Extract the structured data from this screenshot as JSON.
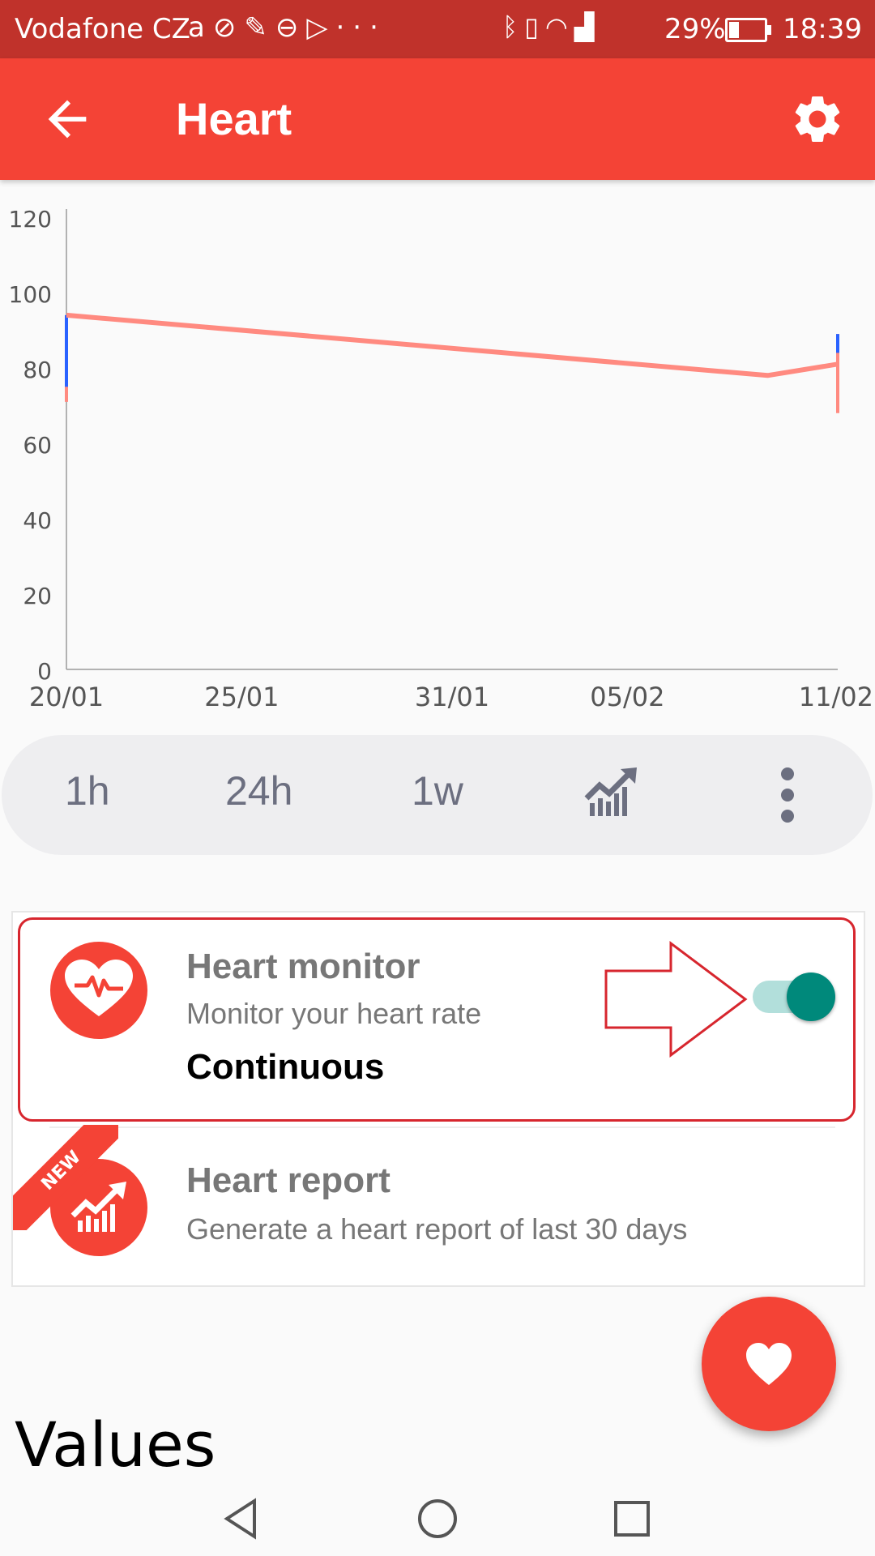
{
  "status_bar": {
    "carrier": "Vodafone CZ",
    "battery": "29%",
    "time": "18:39",
    "left_icons": [
      "a-icon",
      "alarm-off-icon",
      "ghost-icon",
      "pokeball-icon",
      "play-store-icon",
      "more-icon"
    ],
    "right_icons": [
      "bluetooth-icon",
      "vibrate-icon",
      "wifi-icon",
      "signal-icon"
    ]
  },
  "toolbar": {
    "title": "Heart",
    "back_icon": "arrow-back-icon",
    "settings_icon": "gear-icon",
    "color": "#f44336"
  },
  "chart_data": {
    "type": "line",
    "x_ticks": [
      "20/01",
      "25/01",
      "31/01",
      "05/02",
      "11/02"
    ],
    "y_ticks": [
      "0",
      "20",
      "40",
      "60",
      "80",
      "100",
      "120"
    ],
    "ylim": [
      0,
      120
    ],
    "series": [
      {
        "color": "#ff8a80",
        "points": [
          {
            "x": "20/01",
            "y": 94
          },
          {
            "x": "09/02",
            "y": 78
          },
          {
            "x": "11/02",
            "y": 81
          }
        ]
      }
    ],
    "ranges": [
      {
        "x": "20/01",
        "min": 71,
        "max": 94,
        "blue_min": 75,
        "blue_max": 94
      },
      {
        "x": "11/02",
        "min": 68,
        "max": 89,
        "blue_min": 84,
        "blue_max": 89
      }
    ],
    "grid": false,
    "legend": "none"
  },
  "range_selector": {
    "items": [
      "1h",
      "24h",
      "1w"
    ],
    "trend_icon": "trending-chart-icon",
    "more_icon": "more-vert-icon"
  },
  "heart_monitor": {
    "title": "Heart monitor",
    "subtitle": "Monitor your heart rate",
    "value": "Continuous",
    "enabled": true,
    "icon": "heart-pulse-icon"
  },
  "heart_report": {
    "badge": "NEW",
    "title": "Heart report",
    "subtitle": "Generate a heart report of last 30 days",
    "icon": "report-chart-icon"
  },
  "fab": {
    "icon": "heart-icon"
  },
  "values_heading": "Values",
  "nav_bar": [
    "back-triangle-icon",
    "home-circle-icon",
    "recents-square-icon"
  ]
}
